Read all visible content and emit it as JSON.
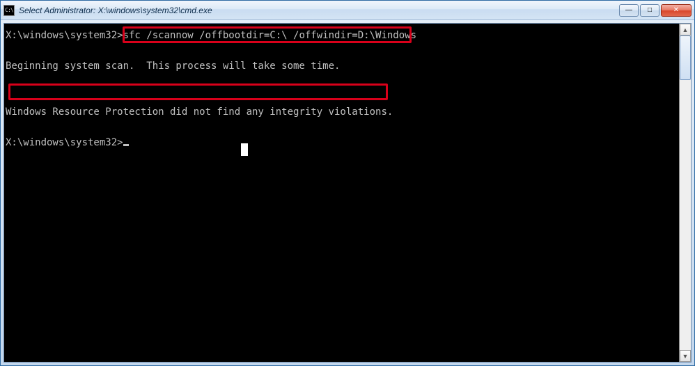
{
  "window": {
    "icon_label": "C:\\",
    "title": "Select Administrator: X:\\windows\\system32\\cmd.exe"
  },
  "console": {
    "prompt1": "X:\\windows\\system32>",
    "command": "sfc /scannow /offbootdir=C:\\ /offwindir=D:\\Windows",
    "line_blank1": "",
    "line_scan": "Beginning system scan.  This process will take some time.",
    "line_blank2": "",
    "line_blank3": "",
    "line_result": "Windows Resource Protection did not find any integrity violations.",
    "line_blank4": "",
    "prompt2": "X:\\windows\\system32>"
  },
  "controls": {
    "minimize_glyph": "—",
    "maximize_glyph": "□",
    "close_glyph": "✕",
    "scroll_up_glyph": "▲",
    "scroll_down_glyph": "▼"
  }
}
